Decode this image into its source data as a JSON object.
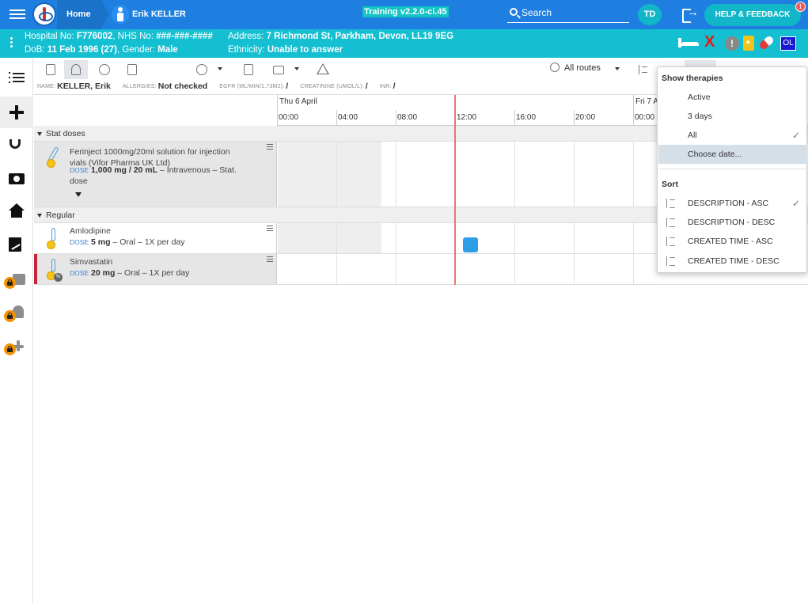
{
  "topbar": {
    "home_label": "Home",
    "patient_name": "Erik KELLER",
    "build_label": "Training v2.2.0-ci.45",
    "search_label": "Search",
    "user_initials": "TD",
    "help_label": "HELP & FEEDBACK",
    "help_badge_count": "1",
    "bar_color": "#1e7fe0"
  },
  "banner": {
    "line1_hospital_prefix": "Hospital No: ",
    "hospital_no": "F776002",
    "nhs_prefix": ", NHS No: ",
    "nhs_no": "###-###-####",
    "dob_prefix": "DoB: ",
    "dob": "11 Feb 1996 (27)",
    "gender_prefix": ", Gender: ",
    "gender": "Male",
    "address_prefix": "Address: ",
    "address": "7 Richmond St, Parkham, Devon, LL19 9EG",
    "ethnicity_prefix": "Ethnicity: ",
    "ethnicity": "Unable to answer",
    "ol_label": "OL",
    "alert_label": "!",
    "x_label": "X",
    "banner_color": "#14bfd2"
  },
  "leftnav": {
    "icons": [
      "list-icon",
      "plus-icon",
      "stethoscope-icon",
      "camera-icon",
      "home-icon",
      "signature-icon",
      "locked-clipboard-icon",
      "locked-walking-icon",
      "locked-medical-icon"
    ]
  },
  "toolbar": {
    "routes_label": "All routes"
  },
  "vitals": {
    "name_label": "NAME:",
    "name_value": "KELLER, Erik",
    "allergies_label": "ALLERGIES:",
    "allergies_value": "Not checked",
    "egfr_label": "EGFR (ML/MIN/1.73M2):",
    "egfr_value": "/",
    "creatinine_label": "CREATININE (UMOL/L):",
    "creatinine_value": "/",
    "inr_label": "INR:",
    "inr_value": "/"
  },
  "timeline": {
    "day1": "Thu 6 April",
    "day2": "Fri 7 A",
    "hours": [
      "00:00",
      "04:00",
      "08:00",
      "12:00",
      "16:00",
      "20:00",
      "00:00"
    ],
    "now_line_color": "#f07070"
  },
  "sections": {
    "stat_label": "Stat doses",
    "regular_label": "Regular"
  },
  "drugs": [
    {
      "name": "Ferinject 1000mg/20ml solution for injection vials (Vifor Pharma UK Ltd)",
      "dose_label": "DOSE",
      "dose_amount": "1,000 mg / 20 mL",
      "dose_rest": " – Intravenous – Stat. dose"
    },
    {
      "name": "Amlodipine",
      "dose_label": "DOSE",
      "dose_amount": "5 mg",
      "dose_rest": " – Oral – 1X per day"
    },
    {
      "name": "Simvastatin",
      "dose_label": "DOSE",
      "dose_amount": "20 mg",
      "dose_rest": " – Oral – 1X per day"
    }
  ],
  "dropdown": {
    "show_header": "Show therapies",
    "show_items": [
      {
        "label": "Active",
        "checked": false
      },
      {
        "label": "3 days",
        "checked": false
      },
      {
        "label": "All",
        "checked": true
      },
      {
        "label": "Choose date...",
        "checked": false
      }
    ],
    "sort_header": "Sort",
    "sort_items": [
      {
        "label": "DESCRIPTION - ASC",
        "checked": true
      },
      {
        "label": "DESCRIPTION - DESC",
        "checked": false
      },
      {
        "label": "CREATED TIME - ASC",
        "checked": false
      },
      {
        "label": "CREATED TIME - DESC",
        "checked": false
      }
    ],
    "check_glyph": "✓",
    "highlight_color": "#d5dfe8"
  },
  "administration_color": "#2e9fe6"
}
